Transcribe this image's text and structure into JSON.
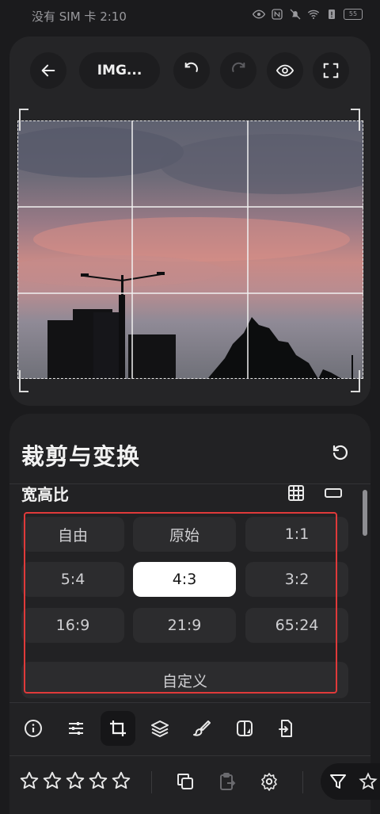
{
  "status_bar": {
    "carrier_time": "没有 SIM 卡 2:10",
    "battery": "55"
  },
  "header": {
    "file_title": "IMG..."
  },
  "panel": {
    "title": "裁剪与变换",
    "aspect_section": "宽高比",
    "ratios": [
      "自由",
      "原始",
      "1:1",
      "5:4",
      "4:3",
      "3:2",
      "16:9",
      "21:9",
      "65:24"
    ],
    "selected_ratio": "4:3",
    "custom_label": "自定义"
  },
  "toolbar": {
    "tools": [
      "info-icon",
      "adjust-sliders-icon",
      "crop-icon",
      "layers-icon",
      "brush-icon",
      "filter-effects-icon",
      "export-file-icon"
    ],
    "selected_tool": "crop-icon"
  },
  "rating": {
    "stars": 0,
    "max": 5
  },
  "colors": {
    "accent_highlight": "#e03a3a",
    "background": "#1b1b1d",
    "card": "#252527"
  }
}
